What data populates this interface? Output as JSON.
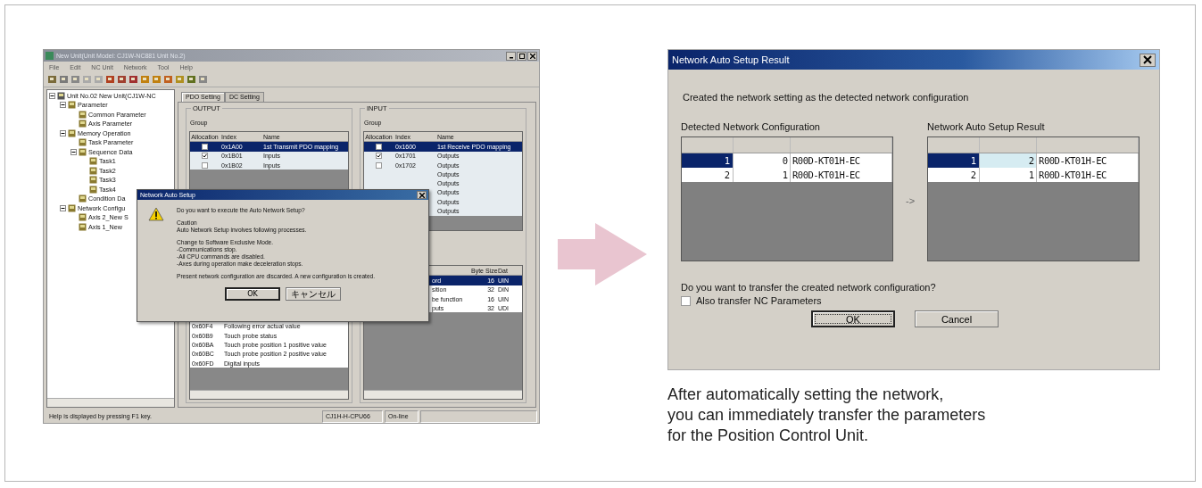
{
  "left_app": {
    "window": {
      "title": "New Unit(Unit Model: CJ1W-NC881 Unit No.2)"
    },
    "menu": [
      "File",
      "Edit",
      "NC Unit",
      "Network",
      "Tool",
      "Help"
    ],
    "tree": [
      {
        "label": "Unit No.02 New Unit(CJ1W-NC",
        "expanded": true,
        "children": [
          {
            "label": "Parameter",
            "expanded": true,
            "children": [
              {
                "label": "Common Parameter"
              },
              {
                "label": "Axis Parameter"
              }
            ]
          },
          {
            "label": "Memory Operation",
            "expanded": true,
            "children": [
              {
                "label": "Task Parameter"
              },
              {
                "label": "Sequence Data",
                "expanded": true,
                "children": [
                  {
                    "label": "Task1"
                  },
                  {
                    "label": "Task2"
                  },
                  {
                    "label": "Task3"
                  },
                  {
                    "label": "Task4"
                  }
                ]
              },
              {
                "label": "Condition Da"
              }
            ]
          },
          {
            "label": "Network Configu",
            "expanded": true,
            "children": [
              {
                "label": "Axis 2_New S"
              },
              {
                "label": "Axis 1_New"
              }
            ]
          }
        ]
      }
    ],
    "tabs": [
      {
        "label": "PDO Setting",
        "selected": true
      },
      {
        "label": "DC Setting",
        "selected": false
      }
    ],
    "output": {
      "title": "OUTPUT",
      "group_label": "Group",
      "columns": [
        "Allocation",
        "Index",
        "Name"
      ],
      "rows": [
        {
          "checked": false,
          "index": "0x1A00",
          "name": "1st Transmit PDO mapping",
          "selected": true
        },
        {
          "checked": true,
          "index": "0x1B01",
          "name": "Inputs",
          "selected": false
        },
        {
          "checked": false,
          "index": "0x1B02",
          "name": "Inputs",
          "selected": false
        }
      ],
      "lower_rows": [
        {
          "index": "0x60F4",
          "name": "Following error actual value"
        },
        {
          "index": "0x60B9",
          "name": "Touch probe status"
        },
        {
          "index": "0x60BA",
          "name": "Touch probe position 1 positive value"
        },
        {
          "index": "0x60BC",
          "name": "Touch probe position 2 positive value"
        },
        {
          "index": "0x60FD",
          "name": "Digital inputs"
        }
      ]
    },
    "input": {
      "title": "INPUT",
      "group_label": "Group",
      "columns": [
        "Allocation",
        "Index",
        "Name"
      ],
      "rows": [
        {
          "checked": false,
          "index": "0x1600",
          "name": "1st Receive PDO mapping",
          "selected": true
        },
        {
          "checked": true,
          "index": "0x1701",
          "name": "Outputs",
          "selected": false
        },
        {
          "checked": false,
          "index": "0x1702",
          "name": "Outputs",
          "selected": false
        },
        {
          "name": "Outputs",
          "selected": false
        },
        {
          "name": "Outputs",
          "selected": false
        },
        {
          "name": "Outputs",
          "selected": false
        },
        {
          "name": "Outputs",
          "selected": false
        },
        {
          "name": "Outputs",
          "selected": false
        }
      ],
      "lower_columns": [
        "Byte Size",
        "Dat"
      ],
      "lower_rows": [
        {
          "name": "ord",
          "size": "16",
          "type": "UIN",
          "selected": true
        },
        {
          "name": "sition",
          "size": "32",
          "type": "DIN",
          "selected": false
        },
        {
          "name": "be function",
          "size": "16",
          "type": "UIN",
          "selected": false
        },
        {
          "name": "puts",
          "size": "32",
          "type": "UDI",
          "selected": false
        }
      ]
    },
    "dialog": {
      "title": "Network Auto Setup",
      "paragraphs": [
        "Do you want to execute the Auto Network Setup?",
        "Caution\nAuto Network Setup involves following processes.",
        "Change to Software Exclusive Mode.\n-Communications stop.\n-All CPU commands are disabled.\n-Axes during operation make deceleration stops.",
        "Present network configuration are discarded. A new configuration is created."
      ],
      "buttons": [
        {
          "label": "OK",
          "default": true
        },
        {
          "label": "キャンセル",
          "default": false
        }
      ]
    },
    "status_bar": [
      "Help is displayed by pressing F1 key.",
      "CJ1H-H-CPU66",
      "On-line"
    ]
  },
  "right_dialog": {
    "title": "Network Auto Setup Result",
    "message": "Created the network setting as the detected network configuration",
    "tables": [
      {
        "title": "Detected Network Configuration",
        "rows": [
          {
            "cells": [
              "1",
              "0",
              "R00D-KT01H-EC"
            ],
            "selected": true,
            "changed": false
          },
          {
            "cells": [
              "2",
              "1",
              "R00D-KT01H-EC"
            ],
            "selected": false,
            "changed": false
          }
        ]
      },
      {
        "title": "Network Auto Setup Result",
        "rows": [
          {
            "cells": [
              "1",
              "2",
              "R00D-KT01H-EC"
            ],
            "selected": true,
            "changed": true
          },
          {
            "cells": [
              "2",
              "1",
              "R00D-KT01H-EC"
            ],
            "selected": false,
            "changed": false
          }
        ]
      }
    ],
    "arrow": "->",
    "question": "Do you want to transfer the created network configuration?",
    "checkbox": {
      "label": "Also transfer NC Parameters",
      "checked": false
    },
    "buttons": [
      {
        "label": "OK",
        "default": true
      },
      {
        "label": "Cancel",
        "default": false
      }
    ]
  },
  "caption": "After automatically setting the network,\nyou can immediately transfer the parameters\nfor the Position Control Unit."
}
